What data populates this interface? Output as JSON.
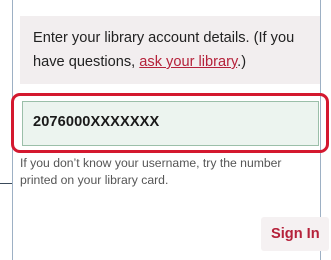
{
  "info": {
    "text_before": "Enter your library account details. (If you have questions, ",
    "link": "ask your library",
    "text_after": ".)"
  },
  "login": {
    "username_value": "2076000XXXXXXX",
    "hint": "If you don’t know your username, try the number printed on your library card.",
    "submit_label": "Sign In"
  },
  "colors": {
    "accent": "#b5213a",
    "highlight_border": "#d4182f",
    "field_background": "#ecf4ef",
    "info_background": "#f2eeef"
  }
}
